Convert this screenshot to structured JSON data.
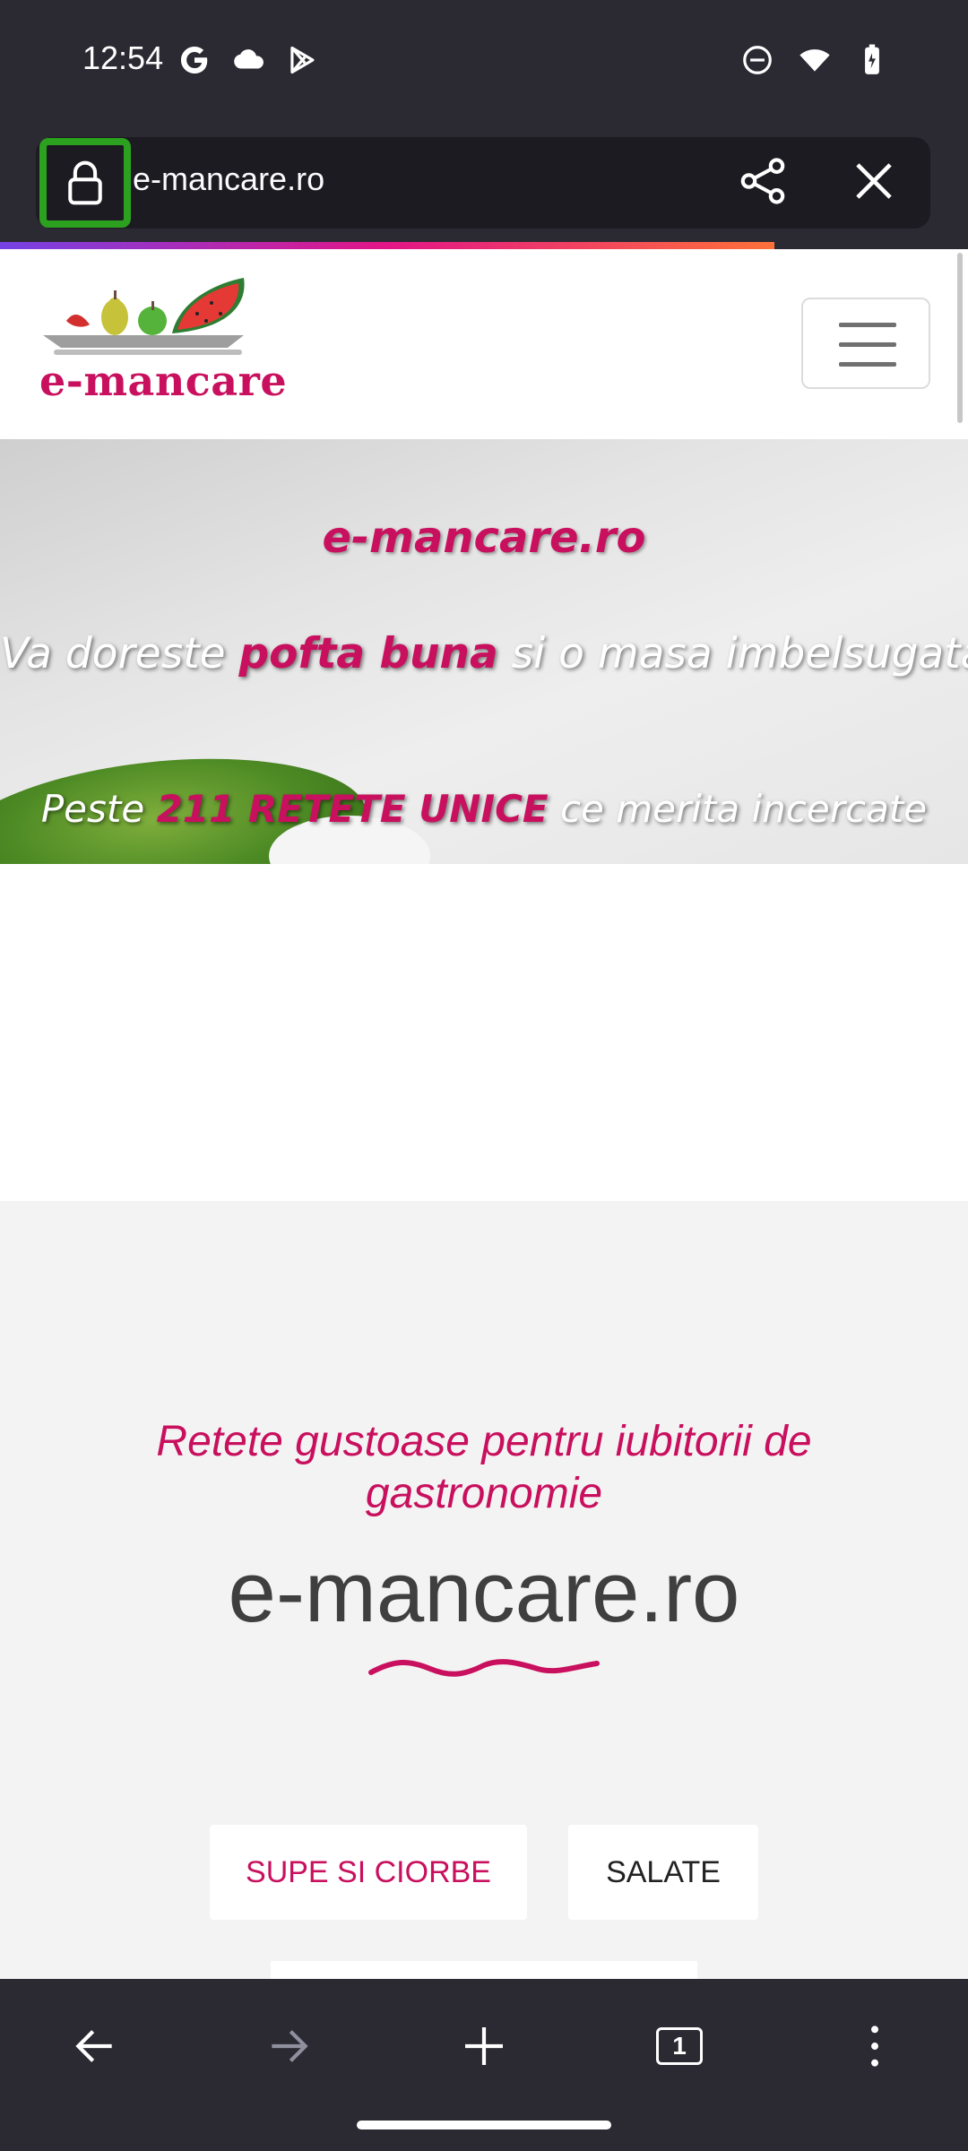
{
  "status_bar": {
    "time": "12:54",
    "left_icons": [
      "google-icon",
      "cloud-icon",
      "play-store-icon"
    ],
    "right_icons": [
      "do-not-disturb-icon",
      "wifi-icon",
      "battery-icon"
    ]
  },
  "browser": {
    "url": "e-mancare.ro",
    "page_load_progress": 0.8,
    "tab_count": "1",
    "colors": {
      "chrome": "#2b2a33",
      "url_pill": "#1c1b22",
      "highlight": "#2ba11f"
    }
  },
  "site": {
    "logo_text": "e-mancare",
    "hero": {
      "line1": "e-mancare.ro",
      "line2_pre": "Va doreste ",
      "line2_highlight": "pofta buna",
      "line2_post": " si o masa imbelsugata",
      "line3_pre": "Peste ",
      "line3_highlight": "211 RETETE UNICE",
      "line3_post": " ce merita incercate"
    },
    "tagline": "Retete gustoase pentru iubitorii de gastronomie",
    "title": "e-mancare.ro",
    "categories": [
      {
        "label": "SUPE SI CIORBE"
      },
      {
        "label": "SALATE"
      }
    ],
    "colors": {
      "accent": "#c8105e",
      "title": "#3f3f3f"
    }
  }
}
